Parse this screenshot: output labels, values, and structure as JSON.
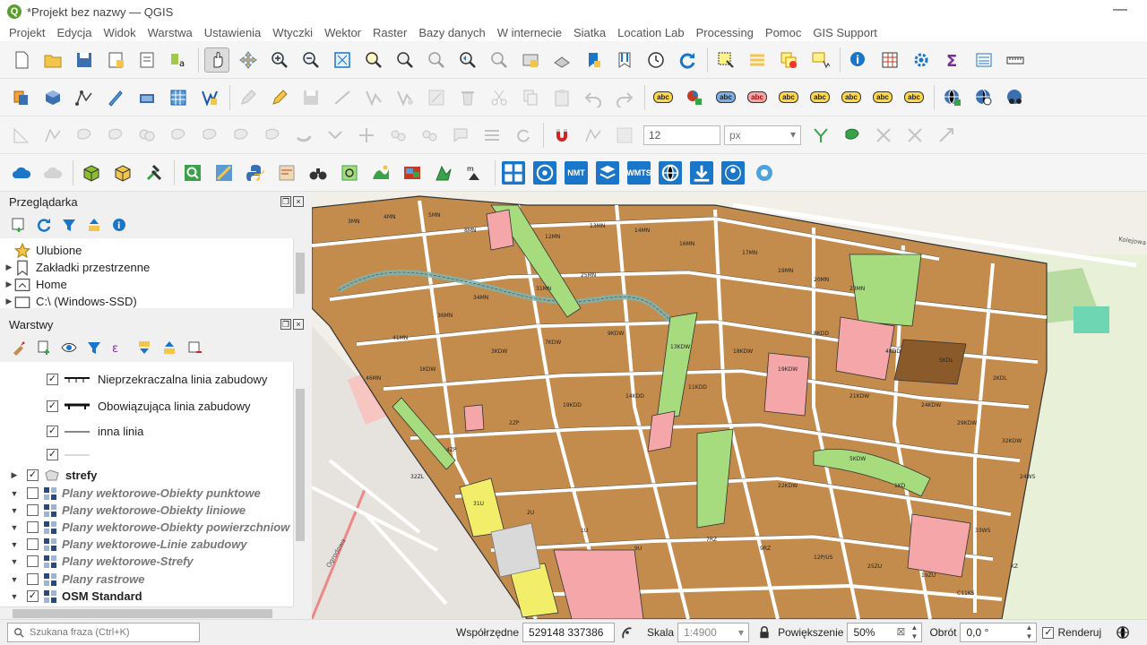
{
  "window": {
    "title": "*Projekt bez nazwy — QGIS",
    "app_icon": "Q"
  },
  "menu": [
    "Projekt",
    "Edycja",
    "Widok",
    "Warstwa",
    "Ustawienia",
    "Wtyczki",
    "Wektor",
    "Raster",
    "Bazy danych",
    "W internecie",
    "Siatka",
    "Location Lab",
    "Processing",
    "Pomoc",
    "GIS Support"
  ],
  "toolbar3": {
    "size_value": "12",
    "size_unit": "px"
  },
  "toolbar4": {
    "nmt": "NMT",
    "wmts": "WMTS"
  },
  "browser_panel": {
    "title": "Przeglądarka",
    "items": [
      "Ulubione",
      "Zakładki przestrzenne",
      "Home",
      "C:\\ (Windows-SSD)"
    ]
  },
  "layers_panel": {
    "title": "Warstwy",
    "legend": [
      {
        "label": "Nieprzekraczalna linia zabudowy",
        "checked": "✓"
      },
      {
        "label": "Obowiązująca linia zabudowy",
        "checked": "✓"
      },
      {
        "label": "inna linia",
        "checked": "✓"
      },
      {
        "label": "",
        "checked": "✓"
      }
    ],
    "layers": [
      {
        "name": "strefy",
        "checked": "✓"
      },
      {
        "name": "Plany wektorowe-Obiekty punktowe",
        "checked": ""
      },
      {
        "name": "Plany wektorowe-Obiekty liniowe",
        "checked": ""
      },
      {
        "name": "Plany wektorowe-Obiekty powierzchniow",
        "checked": ""
      },
      {
        "name": "Plany wektorowe-Linie zabudowy",
        "checked": ""
      },
      {
        "name": "Plany wektorowe-Strefy",
        "checked": ""
      },
      {
        "name": "Plany rastrowe",
        "checked": ""
      },
      {
        "name": "OSM Standard",
        "checked": "✓"
      }
    ]
  },
  "map": {
    "parcel_labels": [
      {
        "t": "3MN"
      },
      {
        "t": "4MN"
      },
      {
        "t": "5MN"
      },
      {
        "t": "8MN"
      },
      {
        "t": "12MN"
      },
      {
        "t": "13MN"
      },
      {
        "t": "14MN"
      },
      {
        "t": "16MN"
      },
      {
        "t": "17MN"
      },
      {
        "t": "19MN"
      },
      {
        "t": "20MN"
      },
      {
        "t": "23MN"
      },
      {
        "t": "25MN"
      },
      {
        "t": "31MN"
      },
      {
        "t": "34MN"
      },
      {
        "t": "36MN"
      },
      {
        "t": "41MN"
      },
      {
        "t": "46MN"
      },
      {
        "t": "1KDW"
      },
      {
        "t": "3KDW"
      },
      {
        "t": "7KDW"
      },
      {
        "t": "9KDW"
      },
      {
        "t": "13KDW"
      },
      {
        "t": "18KDW"
      },
      {
        "t": "19KDW"
      },
      {
        "t": "21KDW"
      },
      {
        "t": "24KDW"
      },
      {
        "t": "29KDW"
      },
      {
        "t": "32KDW"
      },
      {
        "t": "2KDL"
      },
      {
        "t": "5KDL"
      },
      {
        "t": "4KDD"
      },
      {
        "t": "8KDD"
      },
      {
        "t": "11KDD"
      },
      {
        "t": "14KDD"
      },
      {
        "t": "19KDD"
      },
      {
        "t": "2ZP"
      },
      {
        "t": "4ZP"
      },
      {
        "t": "32ZL"
      },
      {
        "t": "31U"
      },
      {
        "t": "2U"
      },
      {
        "t": "1U"
      },
      {
        "t": "9U"
      },
      {
        "t": "7RZ"
      },
      {
        "t": "9RZ"
      },
      {
        "t": "12P/US"
      },
      {
        "t": "25ZU"
      },
      {
        "t": "19ZU"
      },
      {
        "t": "C11KS"
      },
      {
        "t": "KZ"
      },
      {
        "t": "24WS"
      },
      {
        "t": "33WS"
      },
      {
        "t": "1KD"
      },
      {
        "t": "5KDW"
      },
      {
        "t": "22KDW"
      }
    ],
    "road_labels": [
      "Kolejowa",
      "Ogrodowa"
    ]
  },
  "status": {
    "search_placeholder": "Szukana fraza (Ctrl+K)",
    "coord_label": "Współrzędne",
    "coord_value": "529148 337386",
    "scale_label": "Skala",
    "scale_value": "1:4900",
    "zoom_label": "Powiększenie",
    "zoom_value": "50%",
    "rotation_label": "Obrót",
    "rotation_value": "0,0 °",
    "render_label": "Renderuj",
    "render_checked": "✓"
  },
  "colors": {
    "parcel": "#c48c4c",
    "green": "#a6dc7e",
    "pink": "#f4a6a8",
    "yellow": "#f3ee6a",
    "road": "#ffffff",
    "water": "#7cb4b0"
  }
}
